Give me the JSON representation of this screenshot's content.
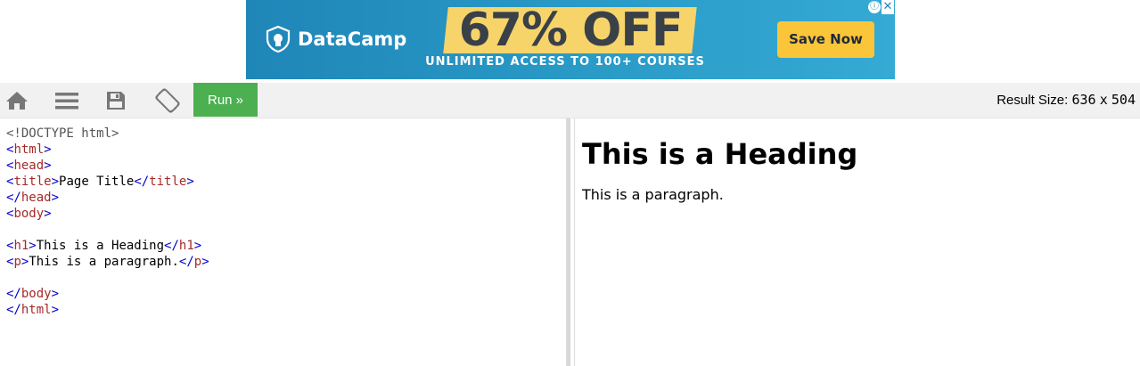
{
  "ad": {
    "brand": "DataCamp",
    "offer": "67% OFF",
    "subtitle": "UNLIMITED ACCESS TO 100+ COURSES",
    "cta": "Save Now",
    "info_glyph": "ⓘ",
    "close_glyph": "✕",
    "colors": {
      "background": "#2a9bc7",
      "highlight": "#f6d46a",
      "cta": "#fbc53a"
    }
  },
  "toolbar": {
    "icons": [
      "home-icon",
      "menu-icon",
      "save-icon",
      "rotate-icon"
    ],
    "run_label": "Run »",
    "result_size_label": "Result Size:",
    "result_width": "636",
    "result_x": "x",
    "result_height": "504",
    "run_color": "#4caf50"
  },
  "editor": {
    "lines": [
      {
        "kind": "doctype",
        "text": "<!DOCTYPE html>"
      },
      {
        "kind": "tag",
        "parts": [
          "<",
          "html",
          ">"
        ]
      },
      {
        "kind": "tag",
        "parts": [
          "<",
          "head",
          ">"
        ]
      },
      {
        "kind": "inline",
        "open": "title",
        "content": "Page Title",
        "close": "title"
      },
      {
        "kind": "tag",
        "parts": [
          "</",
          "head",
          ">"
        ]
      },
      {
        "kind": "tag",
        "parts": [
          "<",
          "body",
          ">"
        ]
      },
      {
        "kind": "blank"
      },
      {
        "kind": "inline",
        "open": "h1",
        "content": "This is a Heading",
        "close": "h1"
      },
      {
        "kind": "inline",
        "open": "p",
        "content": "This is a paragraph.",
        "close": "p"
      },
      {
        "kind": "blank"
      },
      {
        "kind": "tag",
        "parts": [
          "</",
          "body",
          ">"
        ]
      },
      {
        "kind": "tag",
        "parts": [
          "</",
          "html",
          ">"
        ]
      }
    ]
  },
  "result": {
    "heading": "This is a Heading",
    "paragraph": "This is a paragraph."
  }
}
